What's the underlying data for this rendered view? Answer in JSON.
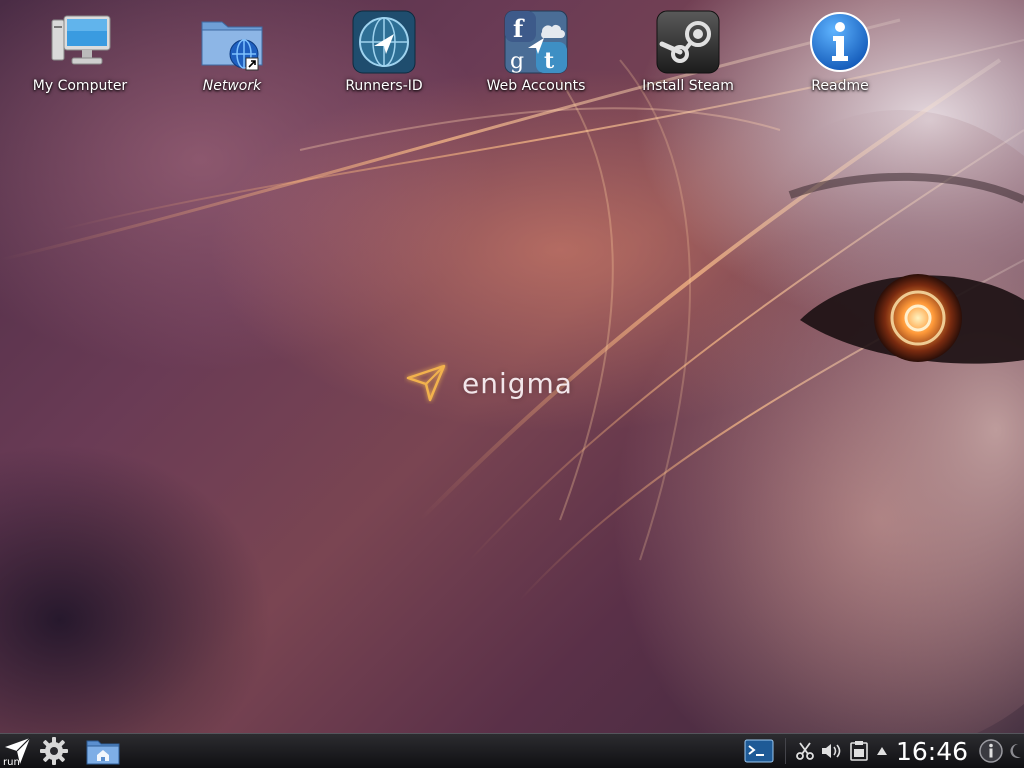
{
  "desktop": {
    "icons": [
      {
        "label": "My Computer",
        "icon": "computer-icon"
      },
      {
        "label": "Network",
        "icon": "network-folder-icon"
      },
      {
        "label": "Runners-ID",
        "icon": "runners-id-icon"
      },
      {
        "label": "Web Accounts",
        "icon": "web-accounts-icon"
      },
      {
        "label": "Install Steam",
        "icon": "steam-icon"
      },
      {
        "label": "Readme",
        "icon": "info-icon"
      }
    ]
  },
  "branding": {
    "logo_text": "enigma"
  },
  "taskbar": {
    "run_label": "run",
    "clock": "16:46"
  },
  "colors": {
    "accent": "#e7a34a",
    "taskbar_bg": "#1a1a1e"
  }
}
